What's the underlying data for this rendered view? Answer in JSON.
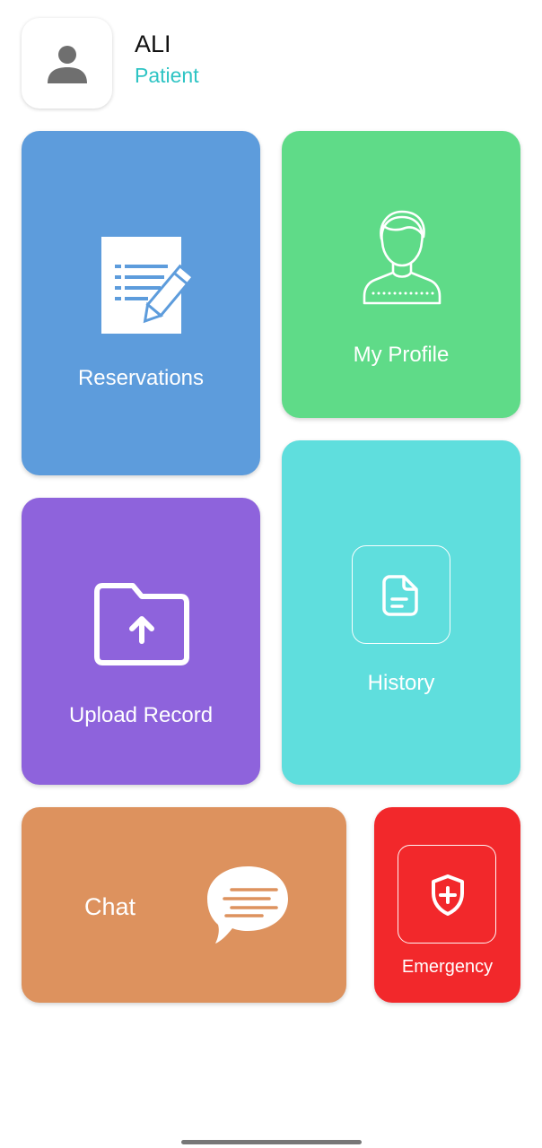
{
  "header": {
    "user_name": "ALI",
    "user_role": "Patient",
    "avatar_icon": "person-icon"
  },
  "tiles": {
    "reservations": {
      "label": "Reservations",
      "icon": "document-edit-icon",
      "color": "#5d9cdc"
    },
    "my_profile": {
      "label": "My Profile",
      "icon": "user-outline-icon",
      "color": "#5fdb88"
    },
    "history": {
      "label": "History",
      "icon": "file-text-icon",
      "color": "#5fdedd"
    },
    "upload_record": {
      "label": "Upload Record",
      "icon": "folder-upload-icon",
      "color": "#8e63dc"
    },
    "chat": {
      "label": "Chat",
      "icon": "chat-bubble-icon",
      "color": "#dd925e"
    },
    "emergency": {
      "label": "Emergency",
      "icon": "shield-plus-icon",
      "color": "#f2282b"
    }
  },
  "colors": {
    "accent": "#2ec4c4"
  }
}
